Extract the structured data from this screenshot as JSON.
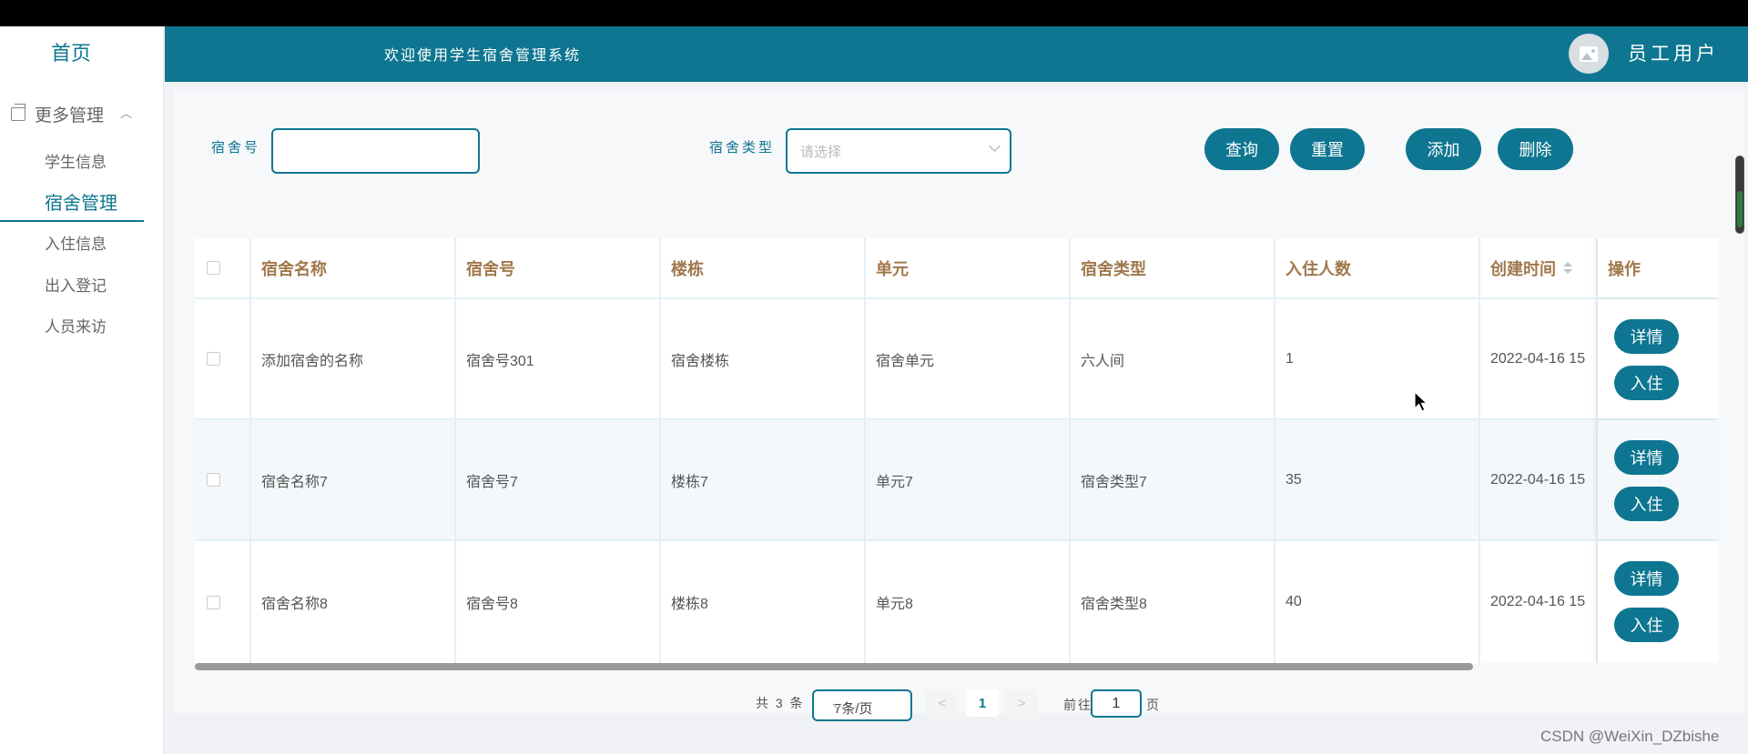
{
  "sidebar": {
    "home": "首页",
    "group_label": "更多管理",
    "items": [
      {
        "label": "学生信息"
      },
      {
        "label": "宿舍管理"
      },
      {
        "label": "入住信息"
      },
      {
        "label": "出入登记"
      },
      {
        "label": "人员来访"
      }
    ],
    "active": "宿舍管理"
  },
  "header": {
    "welcome": "欢迎使用学生宿舍管理系统",
    "user": "员工用户"
  },
  "search": {
    "dorm_no_label": "宿舍号",
    "dorm_no_value": "",
    "dorm_type_label": "宿舍类型",
    "dorm_type_placeholder": "请选择",
    "buttons": {
      "query": "查询",
      "reset": "重置",
      "add": "添加",
      "delete": "删除"
    }
  },
  "table": {
    "columns": [
      "宿舍名称",
      "宿舍号",
      "楼栋",
      "单元",
      "宿舍类型",
      "入住人数",
      "创建时间",
      "操作"
    ],
    "rows": [
      {
        "name": "添加宿舍的名称",
        "no": "宿舍号301",
        "building": "宿舍楼栋",
        "unit": "宿舍单元",
        "type": "六人间",
        "count": "1",
        "created": "2022-04-16 15"
      },
      {
        "name": "宿舍名称7",
        "no": "宿舍号7",
        "building": "楼栋7",
        "unit": "单元7",
        "type": "宿舍类型7",
        "count": "35",
        "created": "2022-04-16 15"
      },
      {
        "name": "宿舍名称8",
        "no": "宿舍号8",
        "building": "楼栋8",
        "unit": "单元8",
        "type": "宿舍类型8",
        "count": "40",
        "created": "2022-04-16 15"
      }
    ],
    "row_actions": {
      "detail": "详情",
      "checkin": "入住"
    }
  },
  "pagination": {
    "total": "共 3 条",
    "page_size": "7条/页",
    "prev": "<",
    "current": "1",
    "next": ">",
    "goto_label": "前往",
    "goto_value": "1",
    "page_suffix": "页"
  },
  "watermark": "CSDN @WeiXin_DZbishe",
  "colors": {
    "primary": "#0e7690",
    "header_text": "#a0784d"
  }
}
